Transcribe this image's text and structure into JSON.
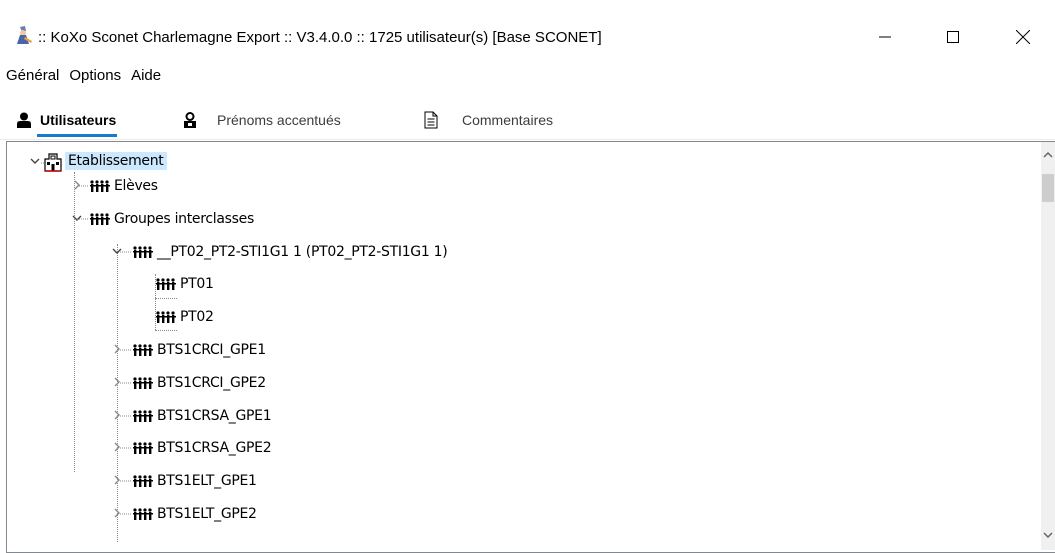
{
  "window": {
    "title": ":: KoXo Sconet Charlemagne Export :: V3.4.0.0 :: 1725 utilisateur(s) [Base SCONET]",
    "icon": "app-wizard-icon"
  },
  "menu": {
    "items": [
      "Général",
      "Options",
      "Aide"
    ]
  },
  "tabs": [
    {
      "label": "Utilisateurs",
      "icon": "user-icon",
      "active": true
    },
    {
      "label": "Prénoms accentués",
      "icon": "user-lock-icon",
      "active": false
    },
    {
      "label": "Commentaires",
      "icon": "document-icon",
      "active": false
    }
  ],
  "tree": {
    "root": {
      "label": "Etablissement",
      "icon": "building-icon",
      "expanded": true,
      "selected": true
    },
    "nodes": [
      {
        "label": "Elèves",
        "level": 1,
        "state": "collapsed"
      },
      {
        "label": "Groupes interclasses",
        "level": 1,
        "state": "expanded"
      },
      {
        "label": "__PT02_PT2-STI1G1 1 (PT02_PT2-STI1G1 1)",
        "level": 2,
        "state": "expanded"
      },
      {
        "label": "PT01",
        "level": 3,
        "state": "leaf"
      },
      {
        "label": "PT02",
        "level": 3,
        "state": "leaf"
      },
      {
        "label": "BTS1CRCI_GPE1",
        "level": 2,
        "state": "collapsed"
      },
      {
        "label": "BTS1CRCI_GPE2",
        "level": 2,
        "state": "collapsed"
      },
      {
        "label": "BTS1CRSA_GPE1",
        "level": 2,
        "state": "collapsed"
      },
      {
        "label": "BTS1CRSA_GPE2",
        "level": 2,
        "state": "collapsed"
      },
      {
        "label": "BTS1ELT_GPE1",
        "level": 2,
        "state": "collapsed"
      },
      {
        "label": "BTS1ELT_GPE2",
        "level": 2,
        "state": "collapsed"
      }
    ]
  },
  "colors": {
    "accent": "#1979ca",
    "selection": "#cce8ff"
  }
}
